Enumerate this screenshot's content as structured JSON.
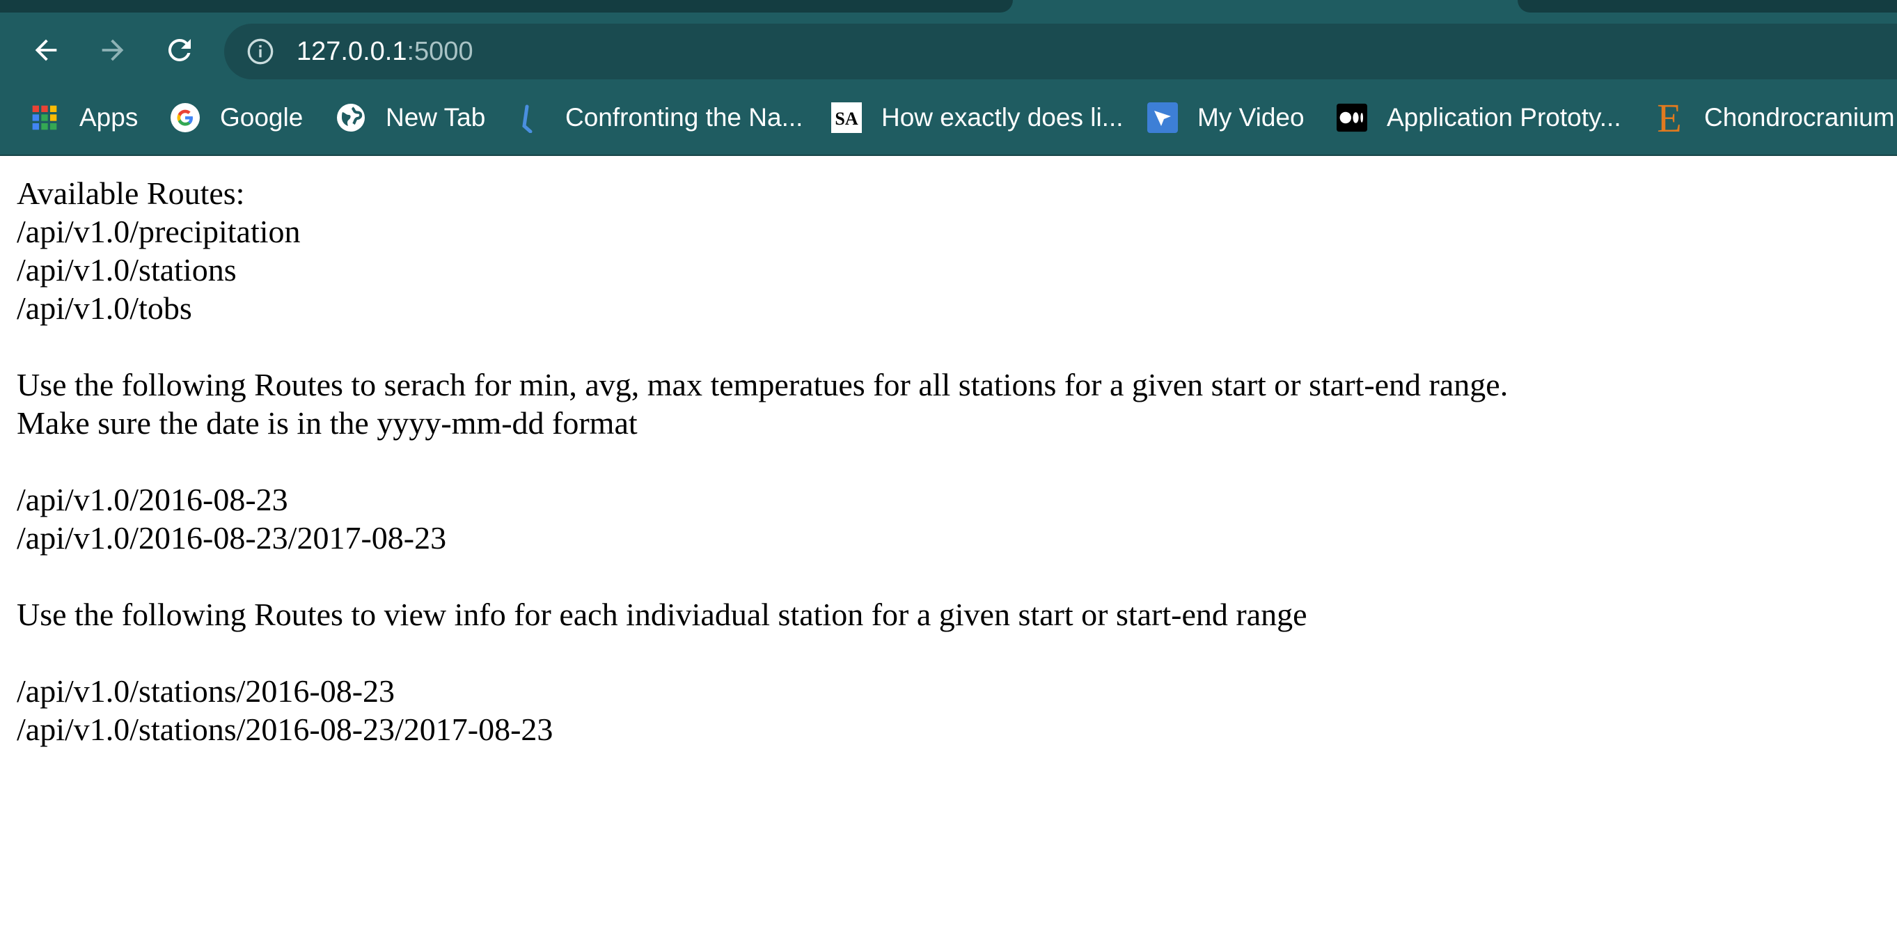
{
  "browser": {
    "url_host": "127.0.0.1",
    "url_port": ":5000",
    "toolbar_color": "#1f5c61",
    "bookmarks": [
      {
        "label": "Apps",
        "icon": "apps-grid-icon"
      },
      {
        "label": "Google",
        "icon": "google-icon"
      },
      {
        "label": "New Tab",
        "icon": "globe-icon"
      },
      {
        "label": "Confronting the Na...",
        "icon": "bookmark-bar-icon"
      },
      {
        "label": "How exactly does li...",
        "icon": "sa-icon"
      },
      {
        "label": "My Video",
        "icon": "video-icon"
      },
      {
        "label": "Application Prototy...",
        "icon": "medium-icon"
      },
      {
        "label": "Chondrocranium",
        "icon": "letter-e-icon"
      }
    ]
  },
  "page": {
    "heading": "Available Routes:",
    "routes": [
      "/api/v1.0/precipitation",
      "/api/v1.0/stations",
      "/api/v1.0/tobs"
    ],
    "temp_instructions": "Use the following Routes to serach for min, avg, max temperatues for all stations for a given start or start-end range.",
    "date_format_note": "Make sure the date is in the yyyy-mm-dd format",
    "temp_routes": [
      "/api/v1.0/2016-08-23",
      "/api/v1.0/2016-08-23/2017-08-23"
    ],
    "station_instructions": "Use the following Routes to view info for each indiviadual station for a given start or start-end range",
    "station_routes": [
      "/api/v1.0/stations/2016-08-23",
      "/api/v1.0/stations/2016-08-23/2017-08-23"
    ]
  }
}
